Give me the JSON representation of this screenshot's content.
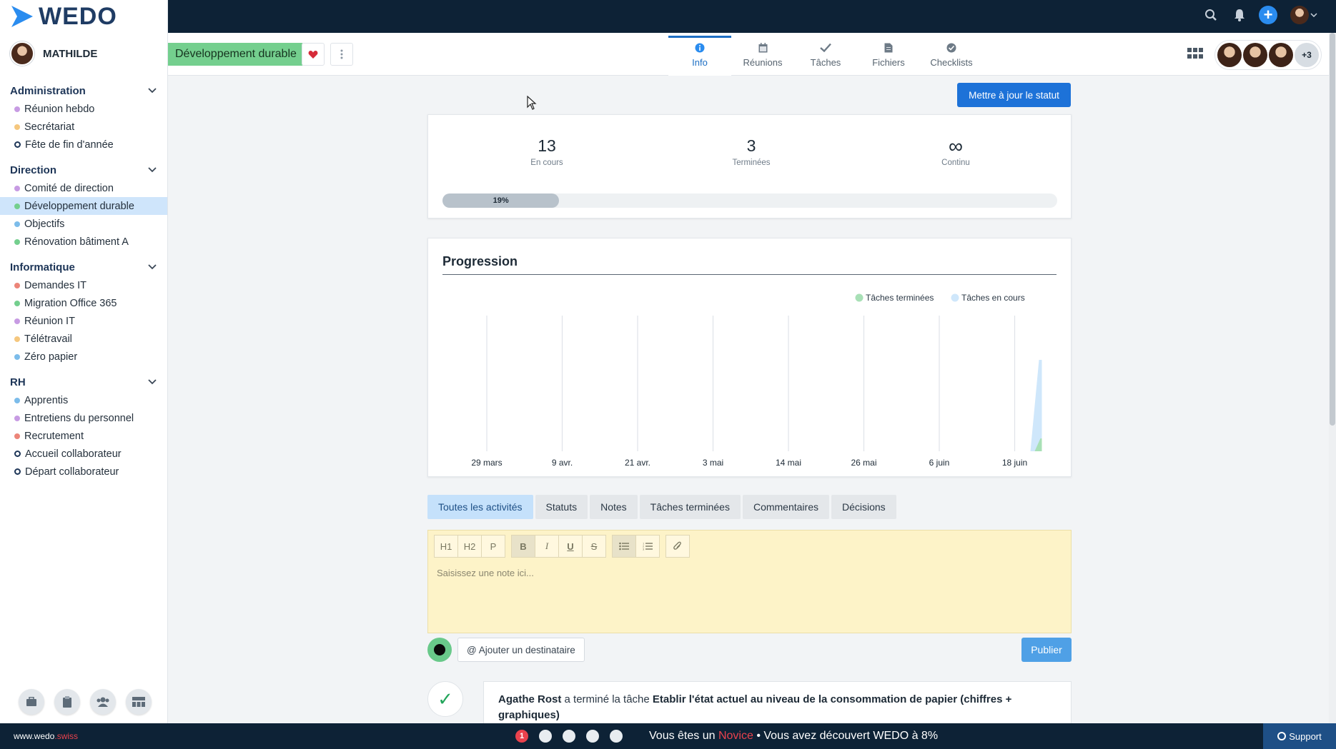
{
  "brand": {
    "name": "WEDO"
  },
  "user": {
    "name": "MATHILDE"
  },
  "sidebar": {
    "sections": [
      {
        "title": "Administration",
        "items": [
          {
            "label": "Réunion hebdo",
            "color": "#c79be3",
            "kind": "dot"
          },
          {
            "label": "Secrétariat",
            "color": "#f5c77e",
            "kind": "dot"
          },
          {
            "label": "Fête de fin d'année",
            "color": "#1d3557",
            "kind": "check"
          }
        ]
      },
      {
        "title": "Direction",
        "items": [
          {
            "label": "Comité de direction",
            "color": "#c79be3",
            "kind": "dot"
          },
          {
            "label": "Développement durable",
            "color": "#74cf8e",
            "kind": "dot",
            "active": true
          },
          {
            "label": "Objectifs",
            "color": "#7cbcea",
            "kind": "dot"
          },
          {
            "label": "Rénovation bâtiment A",
            "color": "#74cf8e",
            "kind": "dot"
          }
        ]
      },
      {
        "title": "Informatique",
        "items": [
          {
            "label": "Demandes IT",
            "color": "#ec8579",
            "kind": "dot"
          },
          {
            "label": "Migration Office 365",
            "color": "#74cf8e",
            "kind": "dot"
          },
          {
            "label": "Réunion IT",
            "color": "#c79be3",
            "kind": "dot"
          },
          {
            "label": "Télétravail",
            "color": "#f5c77e",
            "kind": "dot"
          },
          {
            "label": "Zéro papier",
            "color": "#7cbcea",
            "kind": "dot"
          }
        ]
      },
      {
        "title": "RH",
        "items": [
          {
            "label": "Apprentis",
            "color": "#7cbcea",
            "kind": "dot"
          },
          {
            "label": "Entretiens du personnel",
            "color": "#c79be3",
            "kind": "dot"
          },
          {
            "label": "Recrutement",
            "color": "#ec8579",
            "kind": "dot"
          },
          {
            "label": "Accueil collaborateur",
            "color": "#1d3557",
            "kind": "check"
          },
          {
            "label": "Départ collaborateur",
            "color": "#1d3557",
            "kind": "check"
          }
        ]
      }
    ],
    "bottom_icons": [
      "briefcase-icon",
      "clipboard-icon",
      "team-icon",
      "dashboard-icon"
    ]
  },
  "workspace": {
    "title": "Développement durable",
    "accent": "#74cf8e"
  },
  "tabs": [
    {
      "label": "Info",
      "icon": "info-icon",
      "active": true
    },
    {
      "label": "Réunions",
      "icon": "calendar-icon"
    },
    {
      "label": "Tâches",
      "icon": "check-icon"
    },
    {
      "label": "Fichiers",
      "icon": "file-icon"
    },
    {
      "label": "Checklists",
      "icon": "checklist-icon"
    }
  ],
  "members": {
    "more": "+3"
  },
  "status_button": "Mettre à jour le statut",
  "stats": {
    "in_progress": {
      "value": "13",
      "label": "En cours"
    },
    "done": {
      "value": "3",
      "label": "Terminées"
    },
    "continuous": {
      "value": "∞",
      "label": "Continu"
    },
    "progress_percent": 19,
    "progress_label": "19%"
  },
  "progression": {
    "title": "Progression"
  },
  "chart_data": {
    "type": "area",
    "categories": [
      "29 mars",
      "9 avr.",
      "21 avr.",
      "3 mai",
      "14 mai",
      "26 mai",
      "6 juin",
      "18 juin"
    ],
    "series": [
      {
        "name": "Tâches terminées",
        "color": "#a8e0b6"
      },
      {
        "name": "Tâches en cours",
        "color": "#cfe7fb"
      }
    ],
    "legend": "top-right",
    "grid": true
  },
  "filters": [
    "Toutes les activités",
    "Statuts",
    "Notes",
    "Tâches terminées",
    "Commentaires",
    "Décisions"
  ],
  "editor": {
    "toolbar": [
      "H1",
      "H2",
      "P",
      "B",
      "I",
      "U",
      "S"
    ],
    "placeholder": "Saisissez une note ici..."
  },
  "post": {
    "recipient": "@ Ajouter un destinataire",
    "publish": "Publier"
  },
  "activity": {
    "actor": "Agathe Rost",
    "action": "a terminé la tâche",
    "task": "Etablir l'état actuel au niveau de la consommation de papier (chiffres + graphiques)"
  },
  "footer": {
    "url_main": "www.wedo",
    "url_suffix": ".swiss",
    "first_step": "1",
    "msg_before": "Vous êtes un",
    "level": "Novice",
    "msg_after": "• Vous avez découvert WEDO à 8%",
    "support": "Support"
  }
}
